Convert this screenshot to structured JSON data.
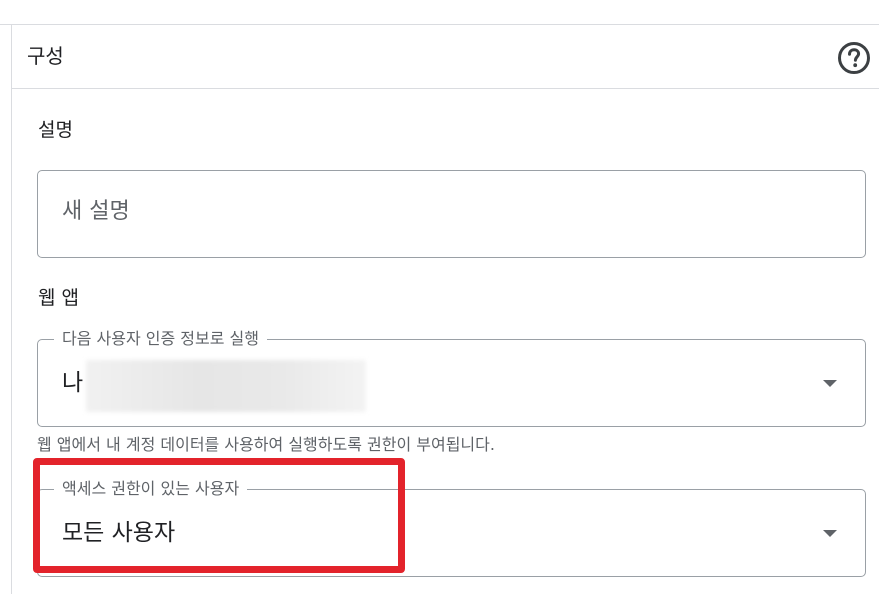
{
  "section": {
    "title": "구성",
    "help_icon": "help-circle-icon"
  },
  "description": {
    "label": "설명",
    "placeholder": "새 설명",
    "value": ""
  },
  "webapp": {
    "label": "웹 앱",
    "execute_as": {
      "legend": "다음 사용자 인증 정보로 실행",
      "value": "나"
    },
    "hint": "웹 앱에서 내 계정 데이터를 사용하여 실행하도록 권한이 부여됩니다.",
    "access": {
      "legend": "액세스 권한이 있는 사용자",
      "value": "모든 사용자"
    }
  },
  "colors": {
    "highlight": "#e3232b",
    "border": "#9aa0a6",
    "text": "#202124",
    "muted": "#5f6368"
  }
}
